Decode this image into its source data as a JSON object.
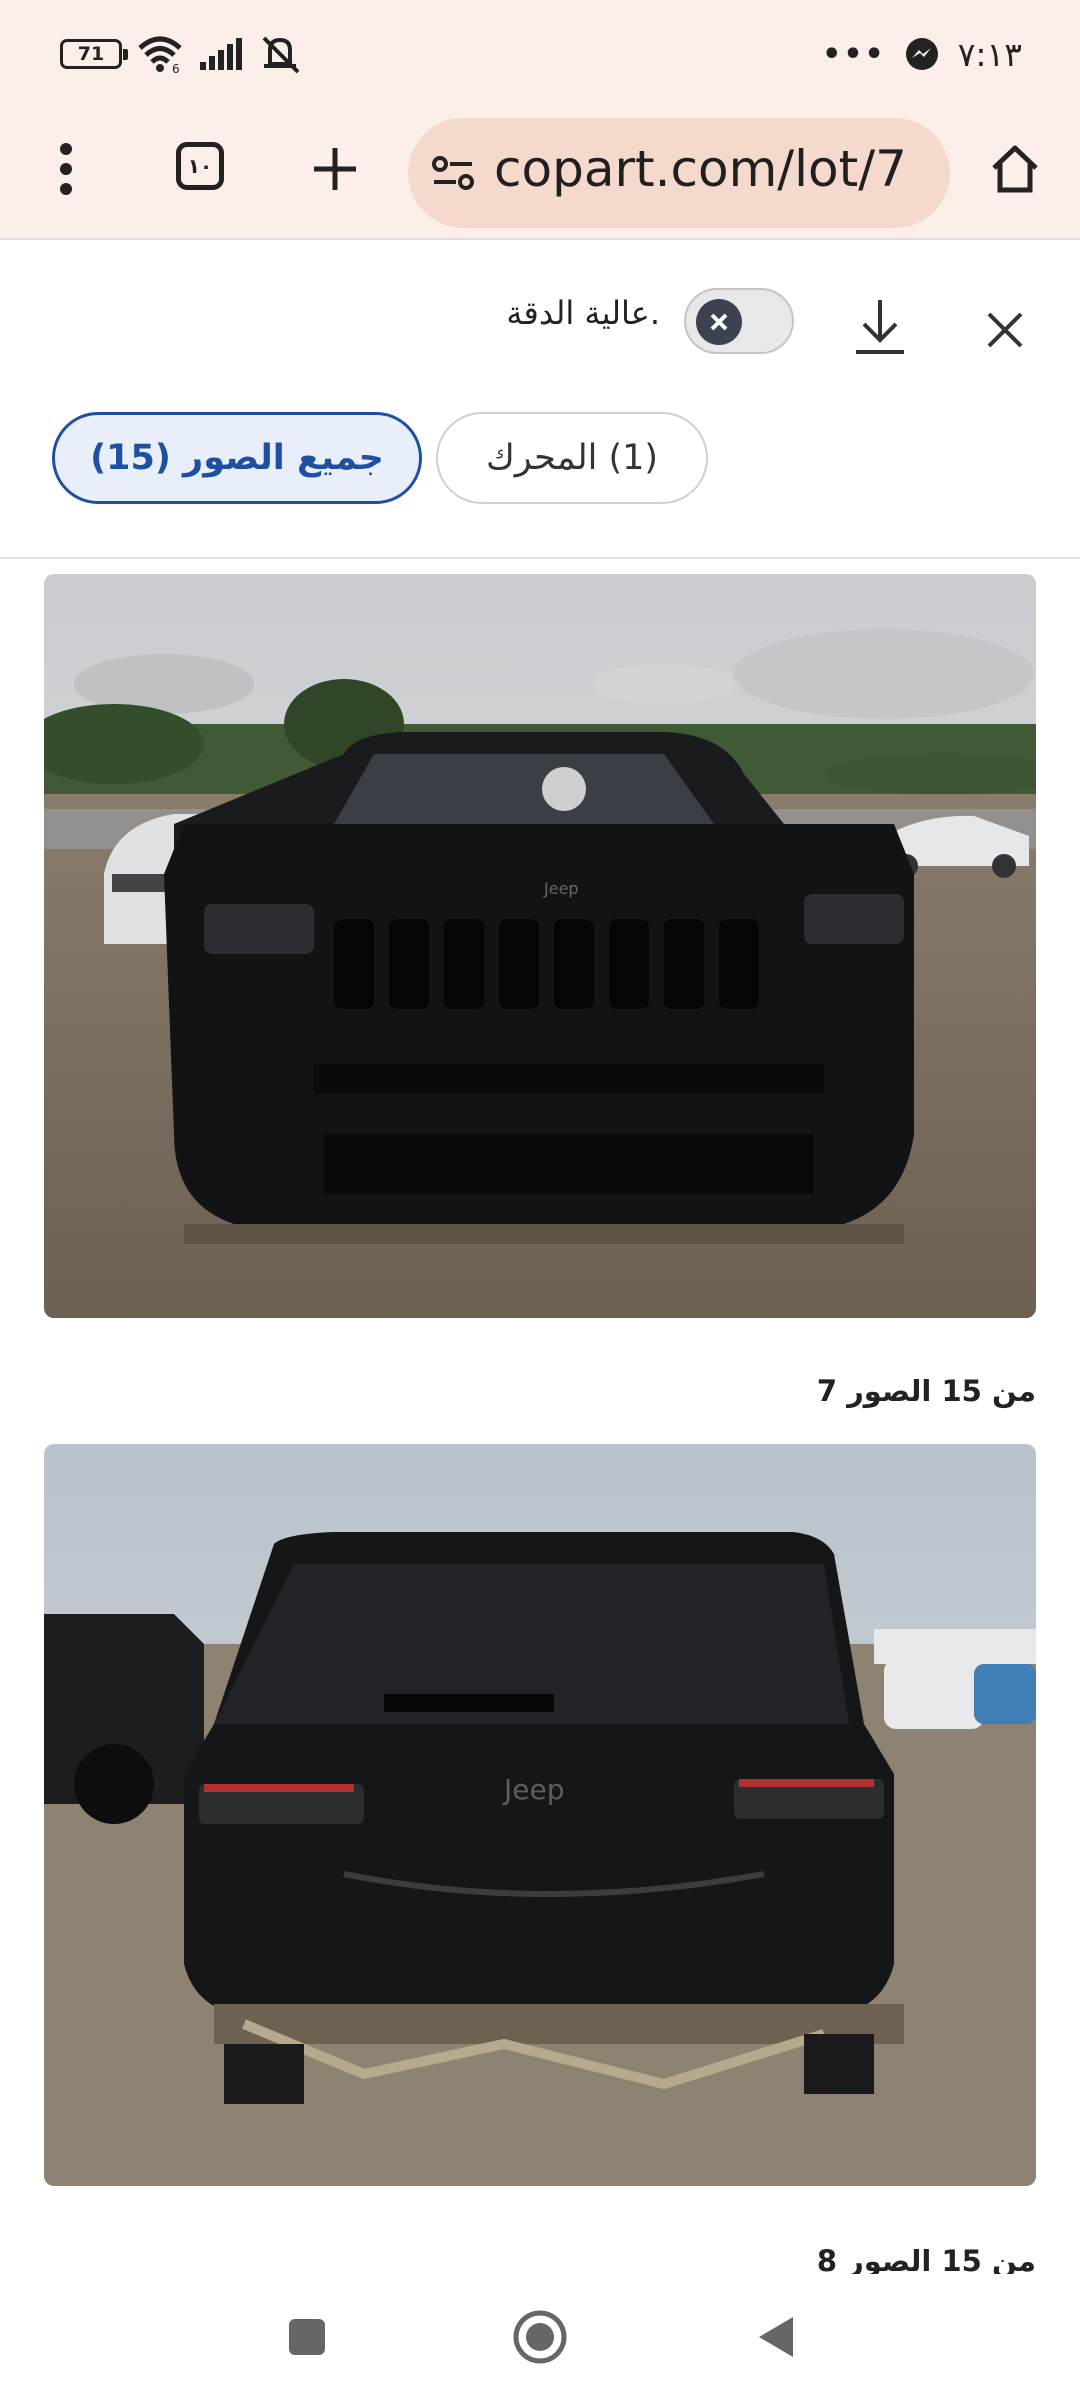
{
  "status_bar": {
    "battery": "71",
    "time": "٧:١٣",
    "more": "•••",
    "icons": [
      "battery-icon",
      "wifi-icon",
      "signal-icon",
      "mute-icon",
      "messenger-icon"
    ]
  },
  "browser": {
    "tab_count": "١٠",
    "url": "copart.com/lot/7",
    "icons": [
      "menu-dots-icon",
      "tabs-icon",
      "plus-icon",
      "site-settings-icon",
      "home-icon"
    ]
  },
  "viewer": {
    "high_res_label": ".عالية الدقة",
    "toggle_on": false,
    "chips": {
      "all_photos": "جميع الصور (15)",
      "engine": "(1) المحرك"
    },
    "photos": [
      {
        "caption": "من 15 الصور 7",
        "subject": "front view of black Jeep in salvage yard"
      },
      {
        "caption": "من 15 الصور 8",
        "subject": "rear view of damaged black Jeep"
      }
    ]
  },
  "nav_bar": {
    "icons": [
      "recents-square-icon",
      "home-circle-icon",
      "back-triangle-icon"
    ]
  }
}
